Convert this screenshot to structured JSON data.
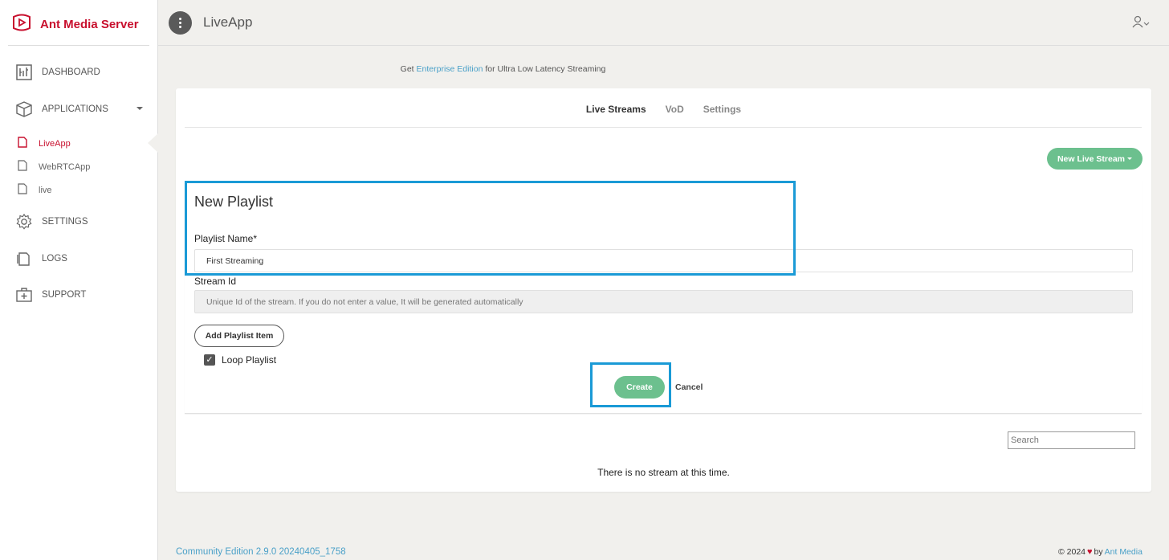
{
  "sidebar": {
    "logo_text": "Ant Media Server",
    "items": [
      {
        "label": "DASHBOARD",
        "icon": "dashboard-icon"
      },
      {
        "label": "APPLICATIONS",
        "icon": "cube-icon"
      },
      {
        "label": "SETTINGS",
        "icon": "gear-icon"
      },
      {
        "label": "LOGS",
        "icon": "logs-icon"
      },
      {
        "label": "SUPPORT",
        "icon": "support-icon"
      }
    ],
    "apps": [
      {
        "label": "LiveApp",
        "active": true
      },
      {
        "label": "WebRTCApp",
        "active": false
      },
      {
        "label": "live",
        "active": false
      }
    ]
  },
  "header": {
    "title": "LiveApp"
  },
  "banner": {
    "prefix": "Get",
    "link": "Enterprise Edition",
    "suffix": "for Ultra Low Latency Streaming"
  },
  "tabs": [
    "Live Streams",
    "VoD",
    "Settings"
  ],
  "new_stream_button": "New Live Stream",
  "form": {
    "title": "New Playlist",
    "playlist_name_label": "Playlist Name*",
    "playlist_name_value": "First Streaming",
    "stream_id_label": "Stream Id",
    "stream_id_placeholder": "Unique Id of the stream. If you do not enter a value, It will be generated automatically",
    "add_item_button": "Add Playlist Item",
    "loop_label": "Loop Playlist",
    "loop_checked": true,
    "create_button": "Create",
    "cancel_button": "Cancel"
  },
  "search": {
    "placeholder": "Search"
  },
  "empty_message": "There is no stream at this time.",
  "footer": {
    "version": "Community Edition 2.9.0 20240405_1758",
    "copyright": "© 2024",
    "by": "by",
    "brand": "Ant Media"
  },
  "colors": {
    "brand_red": "#c8102e",
    "accent_green": "#6cc08e",
    "link_blue": "#4aa0c8",
    "highlight_blue": "#1a9ad6"
  }
}
